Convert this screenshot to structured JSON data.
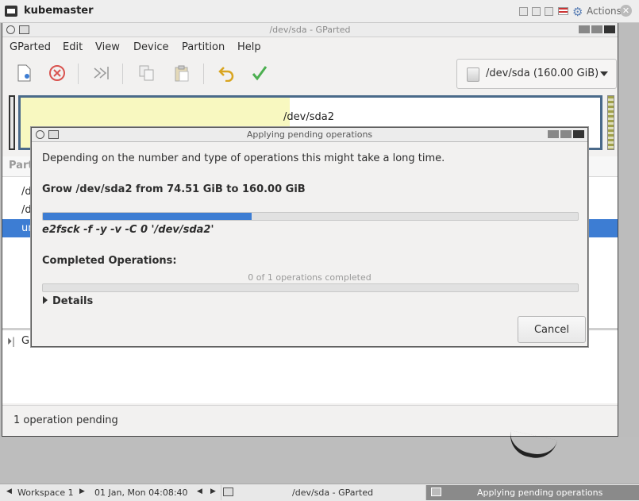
{
  "outer": {
    "title": "kubemaster",
    "actions_label": "Actions"
  },
  "gparted": {
    "window_title": "/dev/sda - GParted",
    "menu": [
      "GParted",
      "Edit",
      "View",
      "Device",
      "Partition",
      "Help"
    ],
    "device_selector": "/dev/sda (160.00 GiB)",
    "partition_name": "/dev/sda2",
    "list_header": "Part",
    "rows": [
      "/d",
      "/d",
      "un"
    ],
    "pending_op_prefix": "G",
    "status": "1 operation pending"
  },
  "dialog": {
    "title": "Applying pending operations",
    "description": "Depending on the number and type of operations this might take a long time.",
    "operation": "Grow /dev/sda2 from 74.51 GiB to 160.00 GiB",
    "operation_progress": 0.39,
    "command": "e2fsck -f -y -v -C 0 '/dev/sda2'",
    "completed_label": "Completed Operations:",
    "completed_count": "0 of 1 operations completed",
    "completed_progress": 0.0,
    "details_label": "Details",
    "cancel_label": "Cancel"
  },
  "taskbar": {
    "workspace": "Workspace 1",
    "datetime": "01 Jan, Mon 04:08:40",
    "task1": "/dev/sda - GParted",
    "task2": "Applying pending operations"
  },
  "colors": {
    "accent": "#3d7dd3",
    "used_space": "#f8f8c0"
  }
}
